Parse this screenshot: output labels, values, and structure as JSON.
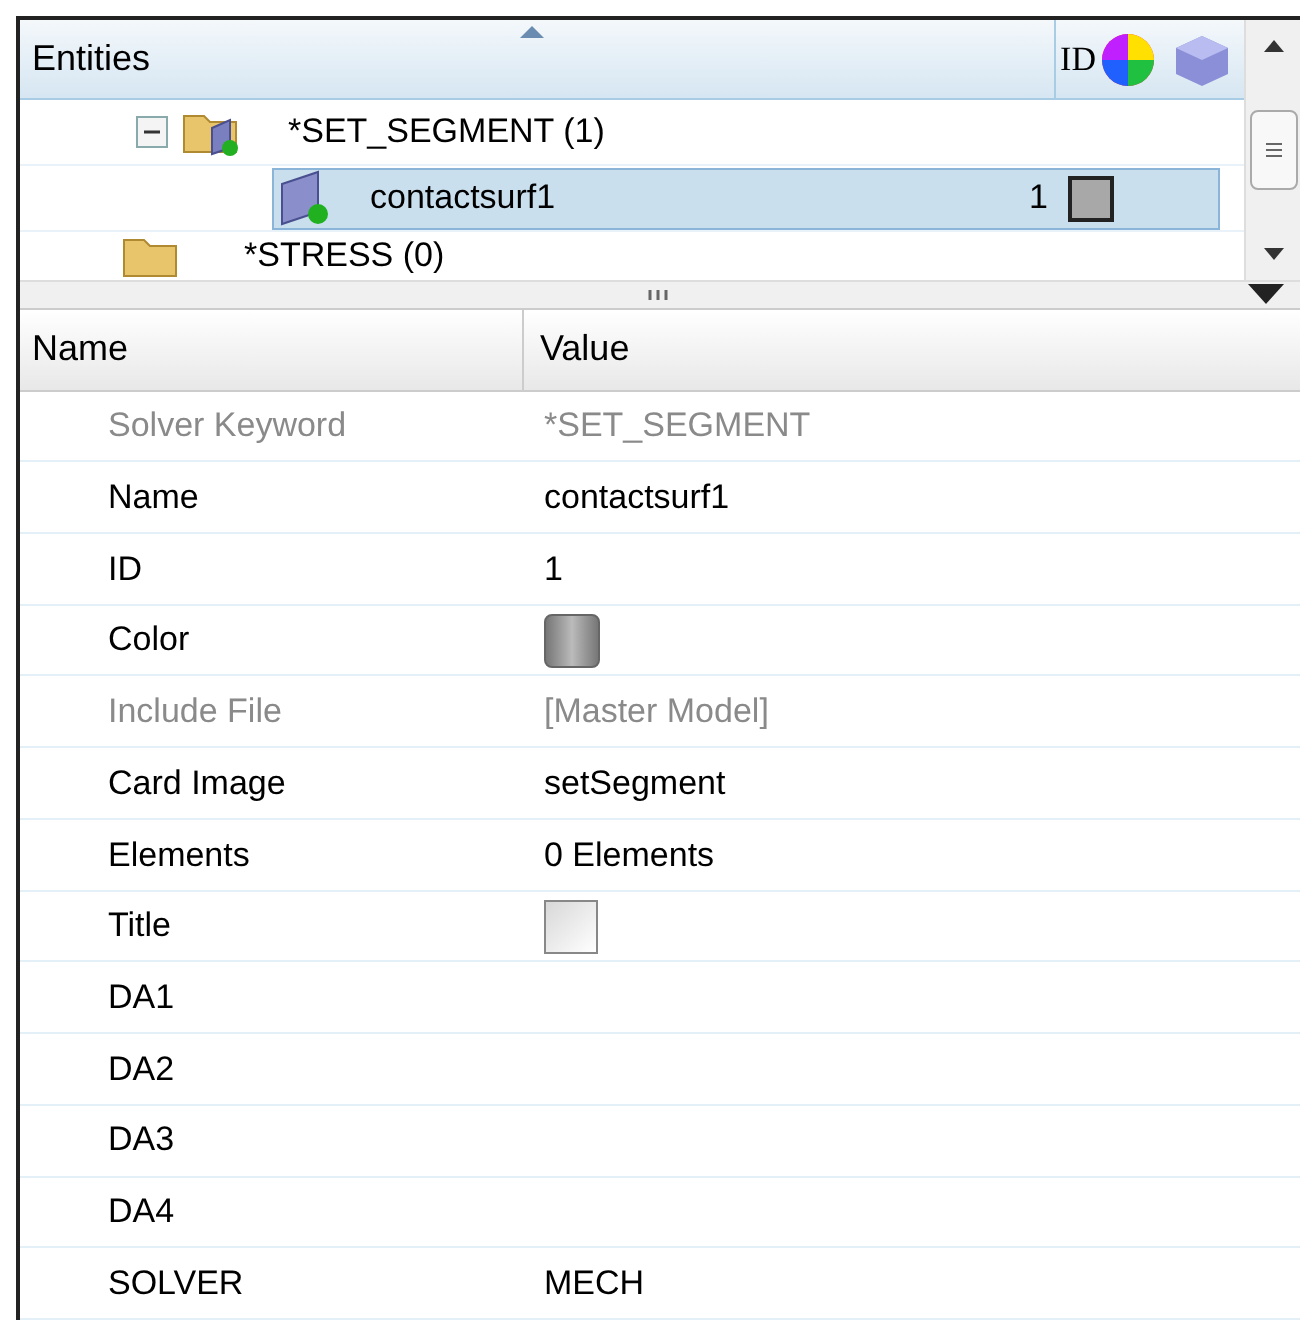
{
  "entity_browser": {
    "header": {
      "title": "Entities",
      "id_column": "ID"
    },
    "tree": [
      {
        "label": "*SET_SEGMENT (1)",
        "expanded": true,
        "selected": false,
        "children": [
          {
            "label": "contactsurf1",
            "id": "1",
            "selected": true
          }
        ]
      },
      {
        "label": "*STRESS (0)",
        "selected": false
      }
    ]
  },
  "properties": {
    "columns": [
      "Name",
      "Value"
    ],
    "rows": [
      {
        "name": "Solver Keyword",
        "kind": "text",
        "value": "*SET_SEGMENT",
        "disabled": true
      },
      {
        "name": "Name",
        "kind": "text",
        "value": "contactsurf1",
        "disabled": false
      },
      {
        "name": "ID",
        "kind": "text",
        "value": "1",
        "disabled": false
      },
      {
        "name": "Color",
        "kind": "swatch",
        "disabled": false
      },
      {
        "name": "Include File",
        "kind": "text",
        "value": "[Master Model]",
        "disabled": true
      },
      {
        "name": "Card Image",
        "kind": "text",
        "value": "setSegment",
        "disabled": false
      },
      {
        "name": "Elements",
        "kind": "text",
        "value": "0 Elements",
        "disabled": false
      },
      {
        "name": "Title",
        "kind": "checkbox",
        "checked": false,
        "disabled": false
      },
      {
        "name": "DA1",
        "kind": "text",
        "disabled": false
      },
      {
        "name": "DA2",
        "kind": "text",
        "disabled": false
      },
      {
        "name": "DA3",
        "kind": "text",
        "disabled": false
      },
      {
        "name": "DA4",
        "kind": "text",
        "disabled": false
      },
      {
        "name": "SOLVER",
        "kind": "text",
        "value": "MECH",
        "disabled": false
      }
    ]
  }
}
